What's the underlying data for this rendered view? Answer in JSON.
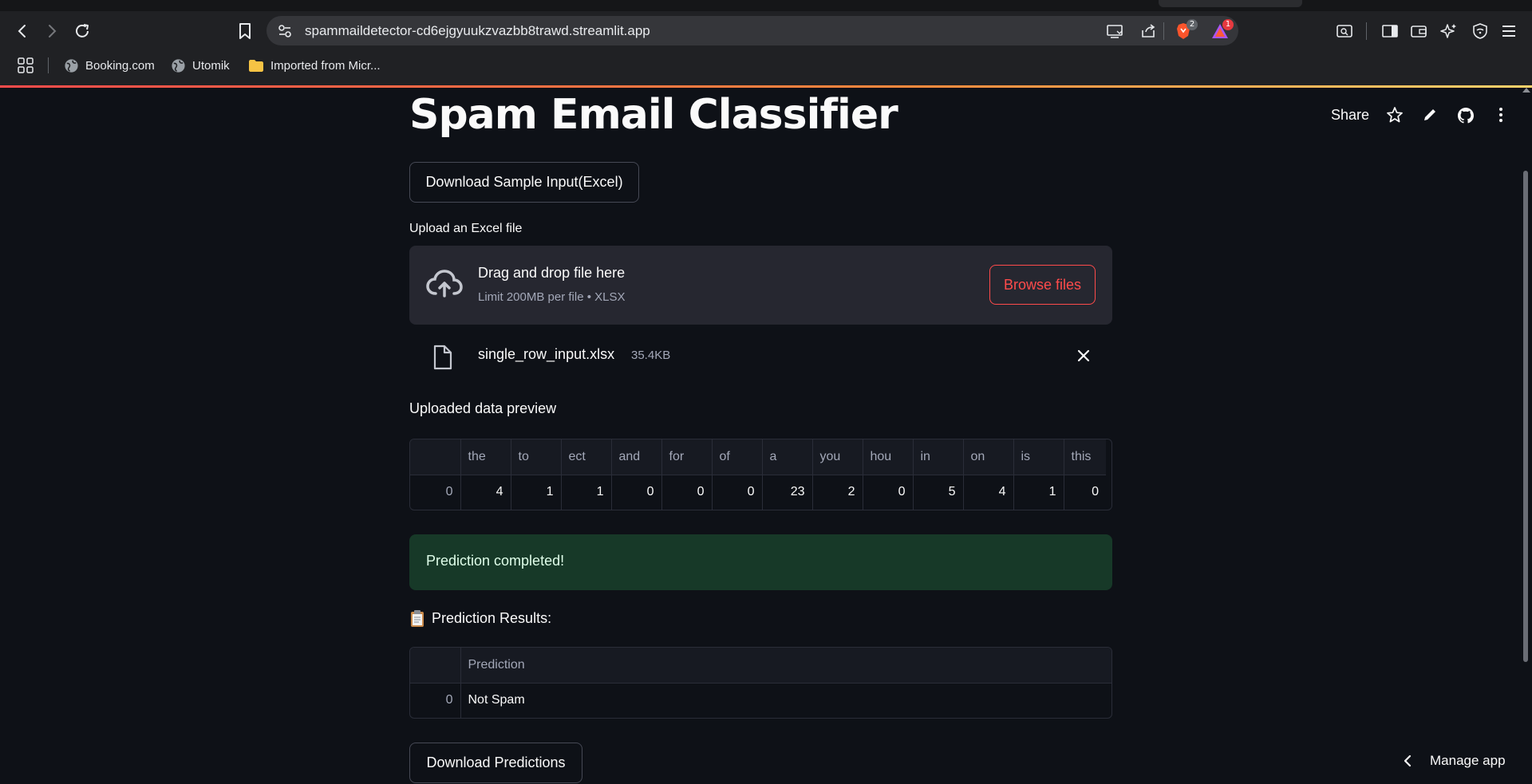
{
  "browser": {
    "url": "spammaildetector-cd6ejgyuukzvazbb8trawd.streamlit.app",
    "brave_badge": "2",
    "rewards_badge": "1",
    "bookmarks": [
      {
        "label": "Booking.com",
        "icon": "globe-icon"
      },
      {
        "label": "Utomik",
        "icon": "globe-icon"
      },
      {
        "label": "Imported from Micr...",
        "icon": "folder-icon"
      }
    ]
  },
  "app": {
    "title": "Spam Email Classifier",
    "share_label": "Share",
    "download_sample_label": "Download Sample Input(Excel)",
    "upload_label": "Upload an Excel file",
    "dropzone": {
      "title": "Drag and drop file here",
      "limit": "Limit 200MB per file • XLSX",
      "browse_label": "Browse files"
    },
    "uploaded_file": {
      "name": "single_row_input.xlsx",
      "size": "35.4KB"
    },
    "preview_heading": "Uploaded data preview",
    "preview_table": {
      "columns": [
        "",
        "the",
        "to",
        "ect",
        "and",
        "for",
        "of",
        "a",
        "you",
        "hou",
        "in",
        "on",
        "is",
        "this"
      ],
      "rows": [
        [
          "0",
          "4",
          "1",
          "1",
          "0",
          "0",
          "0",
          "23",
          "2",
          "0",
          "5",
          "4",
          "1",
          "0"
        ]
      ]
    },
    "success_message": "Prediction completed!",
    "results_heading": "Prediction Results:",
    "results_table": {
      "columns": [
        "",
        "Prediction"
      ],
      "rows": [
        [
          "0",
          "Not Spam"
        ]
      ]
    },
    "download_predictions_label": "Download Predictions",
    "manage_app_label": "Manage app"
  },
  "colors": {
    "background": "#0e1117",
    "accent": "#ff4b4b",
    "success_bg": "#173928"
  }
}
